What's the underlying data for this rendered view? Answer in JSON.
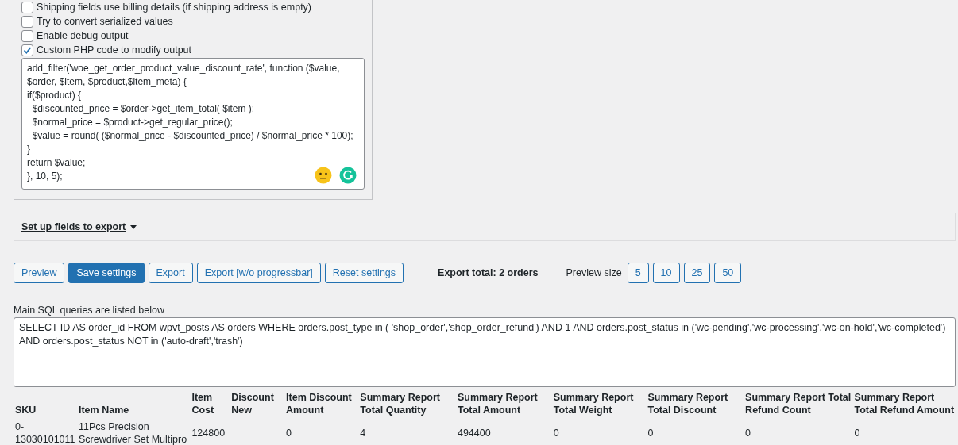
{
  "options": [
    {
      "label": "Shipping fields use billing details (if shipping address is empty)",
      "checked": false
    },
    {
      "label": "Try to convert serialized values",
      "checked": false
    },
    {
      "label": "Enable debug output",
      "checked": false
    },
    {
      "label": "Custom PHP code to modify output",
      "checked": true
    }
  ],
  "code_editor": {
    "value": "add_filter('woe_get_order_product_value_discount_rate', function ($value, $order, $item, $product,$item_meta) {\nif($product) {\n  $discounted_price = $order->get_item_total( $item );\n  $normal_price = $product->get_regular_price();\n  $value = round( ($normal_price - $discounted_price) / $normal_price * 100);\n}\nreturn $value;\n}, 10, 5);"
  },
  "setup_fields": {
    "label": "Set up fields to export"
  },
  "buttons": [
    {
      "label": "Preview",
      "kind": "secondary"
    },
    {
      "label": "Save settings",
      "kind": "primary"
    },
    {
      "label": "Export",
      "kind": "secondary"
    },
    {
      "label": "Export [w/o progressbar]",
      "kind": "secondary"
    },
    {
      "label": "Reset settings",
      "kind": "secondary"
    }
  ],
  "export_total": "Export total: 2 orders",
  "preview_size": {
    "label": "Preview size",
    "options": [
      "5",
      "10",
      "25",
      "50"
    ]
  },
  "sql": {
    "label": "Main SQL queries are listed below",
    "value": "SELECT ID AS order_id FROM wpvt_posts AS orders WHERE orders.post_type in ( 'shop_order','shop_order_refund') AND 1 AND orders.post_status in ('wc-pending','wc-processing','wc-on-hold','wc-completed') AND orders.post_status NOT in ('auto-draft','trash')"
  },
  "table": {
    "columns": [
      "SKU",
      "Item Name",
      "Item Cost",
      "Discount New",
      "Item Discount Amount",
      "Summary Report Total Quantity",
      "Summary Report Total Amount",
      "Summary Report Total Weight",
      "Summary Report Total Discount",
      "Summary Report Total Refund Count",
      "Summary Report Total Refund Amount"
    ],
    "rows": [
      [
        "0-13030101011",
        "11Pcs Precision Screwdriver Set Multipro",
        "124800",
        "",
        "0",
        "4",
        "494400",
        "0",
        "0",
        "0",
        "0"
      ]
    ]
  }
}
